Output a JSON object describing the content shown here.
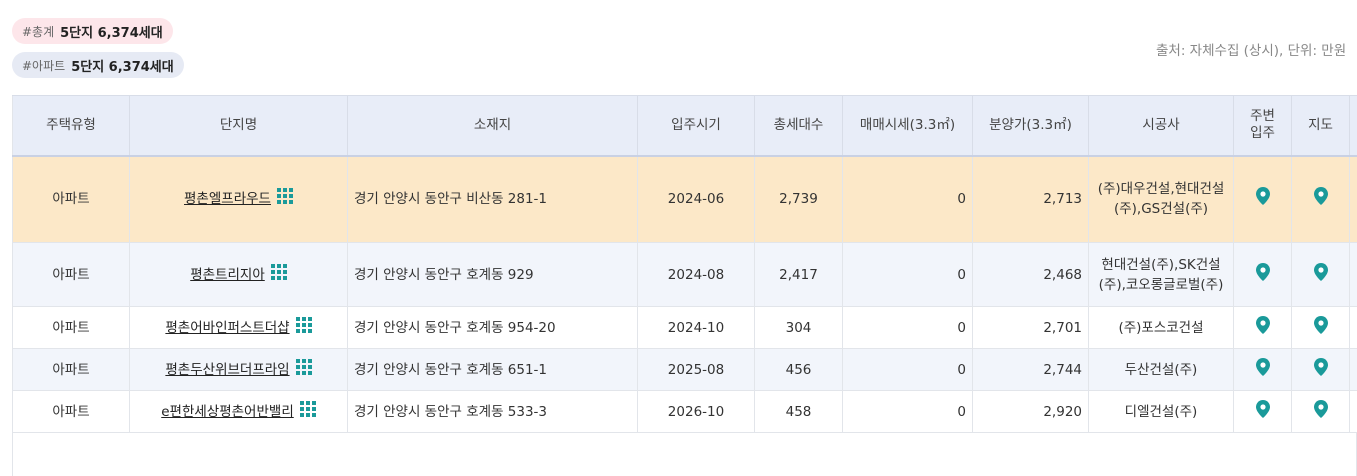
{
  "summary": {
    "total": {
      "tag": "#총계",
      "value": "5단지 6,374세대"
    },
    "apartment": {
      "tag": "#아파트",
      "value": "5단지 6,374세대"
    }
  },
  "source_note": "출처: 자체수집 (상시), 단위: 만원",
  "table": {
    "headers": {
      "type": "주택유형",
      "name": "단지명",
      "address": "소재지",
      "move_in": "입주시기",
      "households": "총세대수",
      "sale_price": "매매시세(3.3㎡)",
      "presale_price": "분양가(3.3㎡)",
      "builder": "시공사",
      "nearby_line1": "주변",
      "nearby_line2": "입주",
      "map": "지도"
    },
    "rows": [
      {
        "type": "아파트",
        "name": "평촌엘프라우드",
        "address": "경기 안양시 동안구 비산동 281-1",
        "move_in": "2024-06",
        "households": "2,739",
        "sale_price": "0",
        "presale_price": "2,713",
        "builder": "(주)대우건설,현대건설(주),GS건설(주)"
      },
      {
        "type": "아파트",
        "name": "평촌트리지아",
        "address": "경기 안양시 동안구 호계동 929",
        "move_in": "2024-08",
        "households": "2,417",
        "sale_price": "0",
        "presale_price": "2,468",
        "builder": "현대건설(주),SK건설(주),코오롱글로벌(주)"
      },
      {
        "type": "아파트",
        "name": "평촌어바인퍼스트더샵",
        "address": "경기 안양시 동안구 호계동 954-20",
        "move_in": "2024-10",
        "households": "304",
        "sale_price": "0",
        "presale_price": "2,701",
        "builder": "(주)포스코건설"
      },
      {
        "type": "아파트",
        "name": "평촌두산위브더프라임",
        "address": "경기 안양시 동안구 호계동 651-1",
        "move_in": "2025-08",
        "households": "456",
        "sale_price": "0",
        "presale_price": "2,744",
        "builder": "두산건설(주)"
      },
      {
        "type": "아파트",
        "name": "e편한세상평촌어반밸리",
        "address": "경기 안양시 동안구 호계동 533-3",
        "move_in": "2026-10",
        "households": "458",
        "sale_price": "0",
        "presale_price": "2,920",
        "builder": "디엘건설(주)"
      }
    ]
  },
  "icons": {
    "complex": "grid-icon",
    "nearby": "map-pin-icon",
    "map": "map-pin-icon"
  },
  "colors": {
    "highlight_row": "#fce8c8",
    "alt_row": "#f2f5fb",
    "header_bg": "#e8edf8",
    "icon_teal": "#1a9a9a"
  }
}
